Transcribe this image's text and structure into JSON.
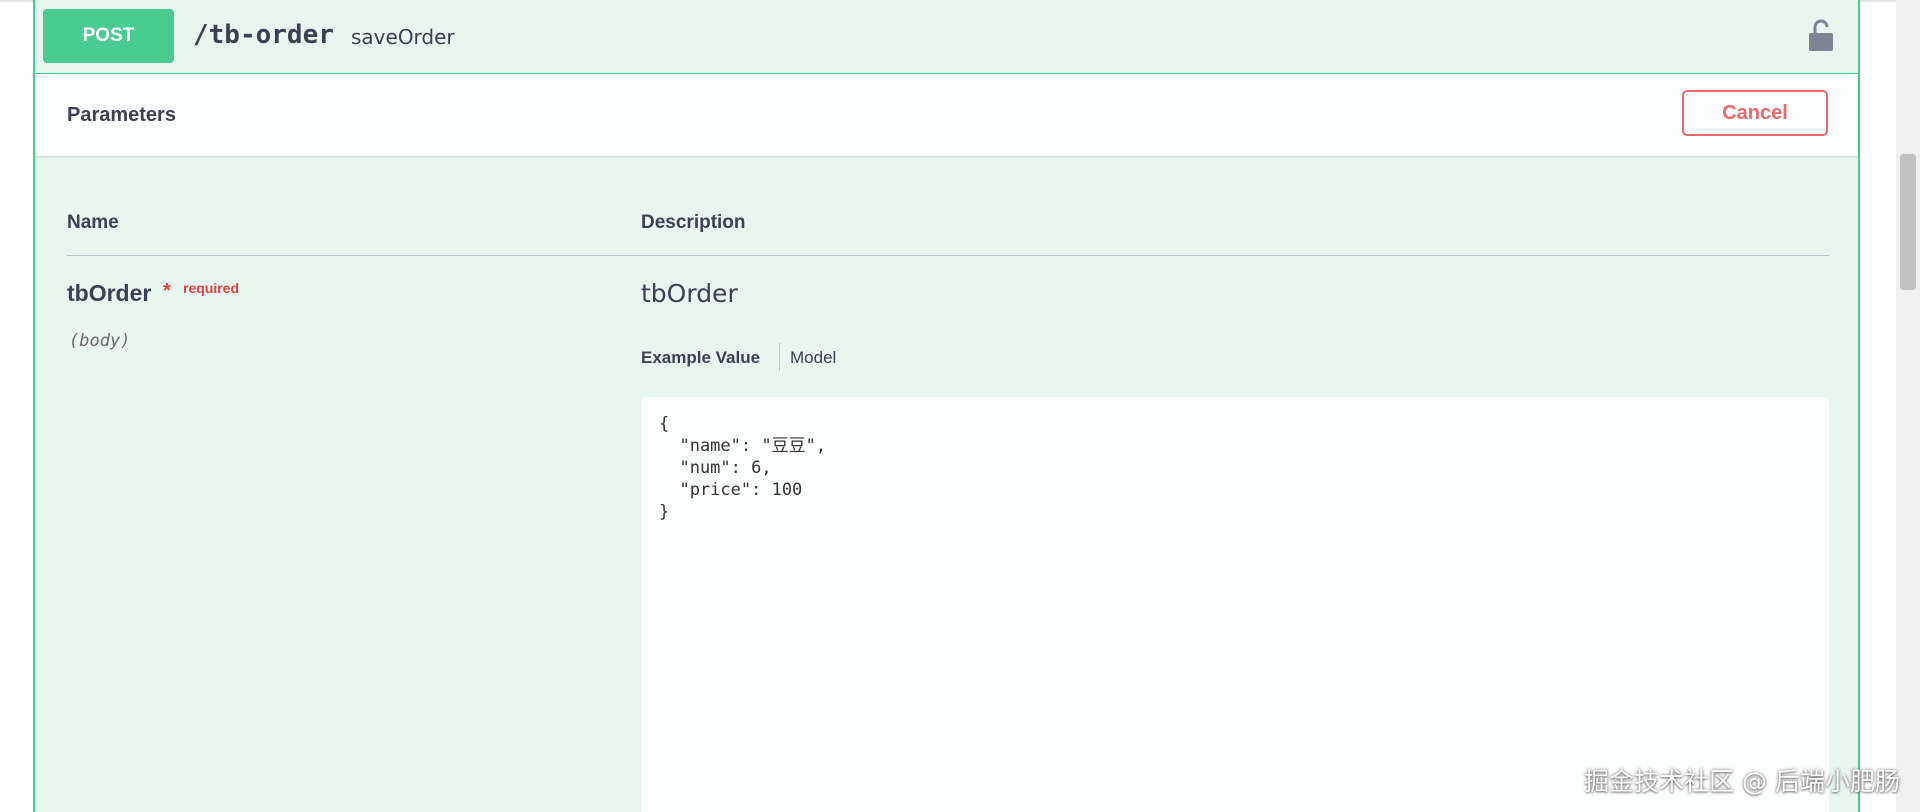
{
  "operation": {
    "method": "POST",
    "path": "/tb-order",
    "summary": "saveOrder",
    "lock_icon": "lock-open-icon"
  },
  "parameters": {
    "title": "Parameters",
    "cancel_label": "Cancel",
    "columns": {
      "name": "Name",
      "description": "Description"
    },
    "items": [
      {
        "name": "tbOrder",
        "required_star": "*",
        "required_label": "required",
        "in": "(body)",
        "description": "tbOrder",
        "tabs": {
          "example": "Example Value",
          "model": "Model"
        },
        "example_value": "{\n  \"name\": \"豆豆\",\n  \"num\": 6,\n  \"price\": 100\n}"
      }
    ]
  },
  "watermark": "掘金技术社区 @ 后端小肥肠",
  "colors": {
    "post_green": "#49cc90",
    "post_bg": "#e8f6f0",
    "cancel_red": "#e86870",
    "required_red": "#e53e3e",
    "text": "#3b4151"
  }
}
